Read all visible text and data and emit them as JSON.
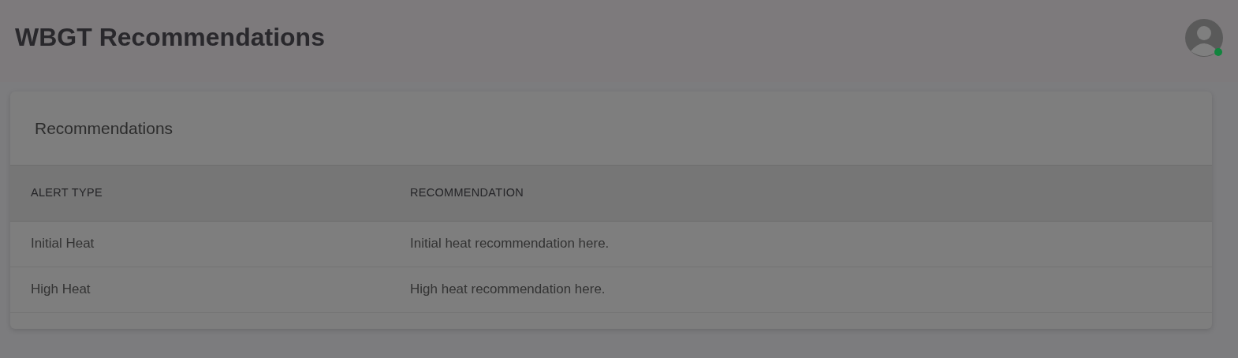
{
  "page_title": "WBGT Recommendations",
  "user": {
    "online": true
  },
  "card": {
    "title": "Recommendations",
    "table": {
      "columns": [
        "ALERT TYPE",
        "RECOMMENDATION"
      ],
      "rows": [
        {
          "alert_type": "Initial Heat",
          "recommendation": "Initial heat recommendation here."
        },
        {
          "alert_type": "High Heat",
          "recommendation": "High heat recommendation here."
        }
      ]
    }
  }
}
